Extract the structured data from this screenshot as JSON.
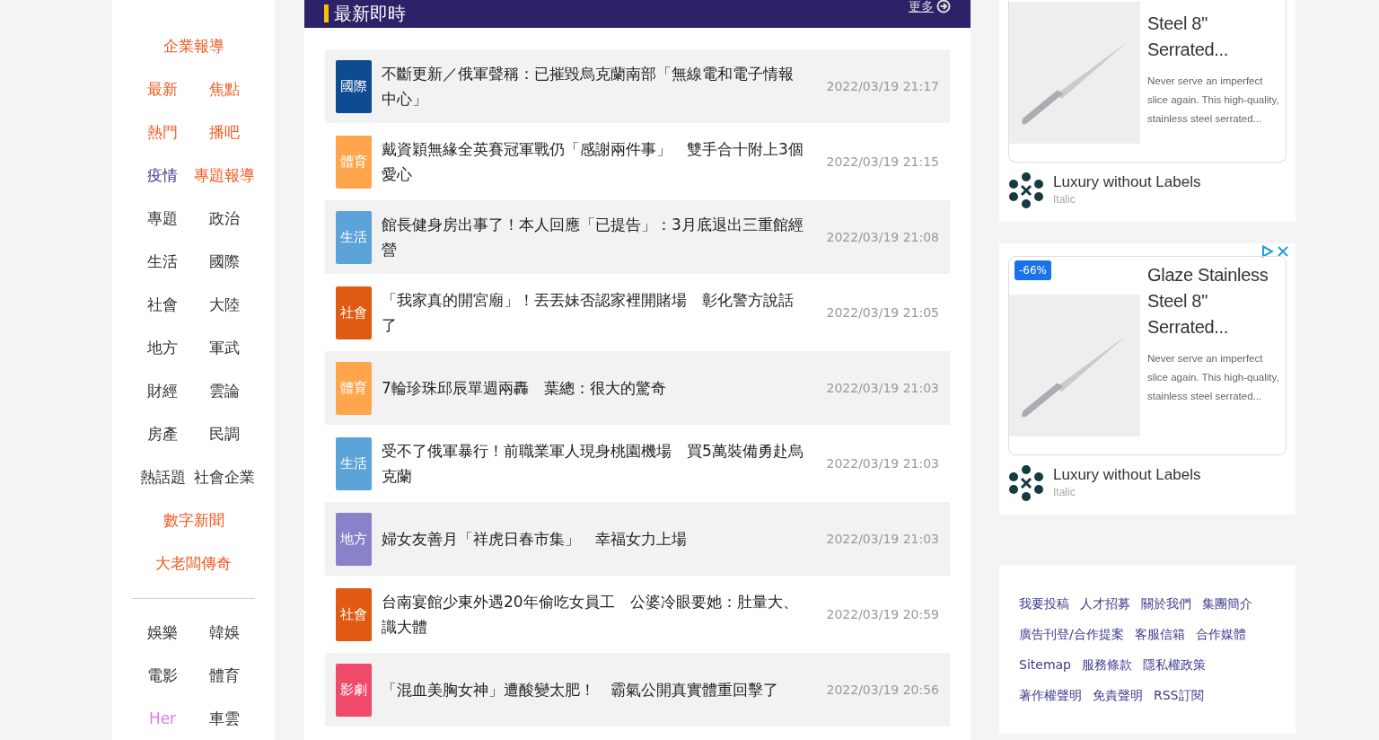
{
  "sidebar": {
    "sections": [
      {
        "rows": [
          [
            {
              "label": "企業報導",
              "color": "#f05a22"
            }
          ],
          [
            {
              "label": "最新",
              "color": "#f05a22"
            },
            {
              "label": "焦點",
              "color": "#f05a22"
            }
          ],
          [
            {
              "label": "熱門",
              "color": "#f05a22"
            },
            {
              "label": "播吧",
              "color": "#f05a22"
            }
          ],
          [
            {
              "label": "疫情",
              "color": "#3e3a8c"
            },
            {
              "label": "專題報導",
              "color": "#f05a22"
            }
          ],
          [
            {
              "label": "專題",
              "color": "#333333"
            },
            {
              "label": "政治",
              "color": "#333333"
            }
          ],
          [
            {
              "label": "生活",
              "color": "#333333"
            },
            {
              "label": "國際",
              "color": "#333333"
            }
          ],
          [
            {
              "label": "社會",
              "color": "#333333"
            },
            {
              "label": "大陸",
              "color": "#333333"
            }
          ],
          [
            {
              "label": "地方",
              "color": "#333333"
            },
            {
              "label": "軍武",
              "color": "#333333"
            }
          ],
          [
            {
              "label": "財經",
              "color": "#333333"
            },
            {
              "label": "雲論",
              "color": "#333333"
            }
          ],
          [
            {
              "label": "房產",
              "color": "#333333"
            },
            {
              "label": "民調",
              "color": "#333333"
            }
          ],
          [
            {
              "label": "熱話題",
              "color": "#333333"
            },
            {
              "label": "社會企業",
              "color": "#333333"
            }
          ],
          [
            {
              "label": "數字新聞",
              "color": "#f05a22"
            }
          ],
          [
            {
              "label": "大老闆傳奇",
              "color": "#f05a22"
            }
          ]
        ]
      },
      {
        "rows": [
          [
            {
              "label": "娛樂",
              "color": "#333333"
            },
            {
              "label": "韓娛",
              "color": "#333333"
            }
          ],
          [
            {
              "label": "電影",
              "color": "#333333"
            },
            {
              "label": "體育",
              "color": "#333333"
            }
          ],
          [
            {
              "label": "Her",
              "color": "#e07ce0"
            },
            {
              "label": "車雲",
              "color": "#333333"
            }
          ]
        ]
      }
    ]
  },
  "news": {
    "title": "最新即時",
    "more": "更多",
    "items": [
      {
        "tag": "國際",
        "color": "#0e4c92",
        "headline": "不斷更新／俄軍聲稱：已摧毀烏克蘭南部「無線電和電子情報中心」",
        "time": "2022/03/19 21:17"
      },
      {
        "tag": "體育",
        "color": "#ffa64d",
        "headline": "戴資穎無緣全英賽冠軍戰仍「感謝兩件事」　雙手合十附上3個愛心",
        "time": "2022/03/19 21:15"
      },
      {
        "tag": "生活",
        "color": "#5ba3d9",
        "headline": "館長健身房出事了！本人回應「已提告」：3月底退出三重館經營",
        "time": "2022/03/19 21:08"
      },
      {
        "tag": "社會",
        "color": "#e05a14",
        "headline": "「我家真的開宮廟」！丟丟妹否認家裡開賭場　彰化警方說話了",
        "time": "2022/03/19 21:05"
      },
      {
        "tag": "體育",
        "color": "#ffa64d",
        "headline": "7輪珍珠邱辰單週兩轟　葉總：很大的驚奇",
        "time": "2022/03/19 21:03"
      },
      {
        "tag": "生活",
        "color": "#5ba3d9",
        "headline": "受不了俄軍暴行！前職業軍人現身桃園機場　買5萬裝備勇赴烏克蘭",
        "time": "2022/03/19 21:03"
      },
      {
        "tag": "地方",
        "color": "#8882c8",
        "headline": "婦女友善月「祥虎日春市集」　幸福女力上場",
        "time": "2022/03/19 21:03"
      },
      {
        "tag": "社會",
        "color": "#e05a14",
        "headline": "台南宴館少東外遇20年偷吃女員工　公婆冷眼要她：肚量大、識大體",
        "time": "2022/03/19 20:59"
      },
      {
        "tag": "影劇",
        "color": "#f04a6a",
        "headline": "「混血美胸女神」遭酸變太肥！　霸氣公開真實體重回擊了",
        "time": "2022/03/19 20:56"
      }
    ]
  },
  "ads": [
    {
      "title": "Steel 8\" Serrated...",
      "body": "Never serve an imperfect slice again. This high-quality, stainless steel serrated...",
      "brand": "Luxury without Labels",
      "sub": "Italic"
    },
    {
      "badge": "-66%",
      "title": "Glaze Stainless Steel 8\" Serrated...",
      "body": "Never serve an imperfect slice again. This high-quality, stainless steel serrated...",
      "brand": "Luxury without Labels",
      "sub": "Italic"
    }
  ],
  "footer_links": [
    [
      "我要投稿",
      "人才招募",
      "關於我們",
      "集團簡介"
    ],
    [
      "廣告刊登/合作提案",
      "客服信箱",
      "合作媒體"
    ],
    [
      "Sitemap",
      "服務條款",
      "隱私權政策"
    ],
    [
      "著作權聲明",
      "免責聲明",
      "RSS訂閱"
    ]
  ]
}
